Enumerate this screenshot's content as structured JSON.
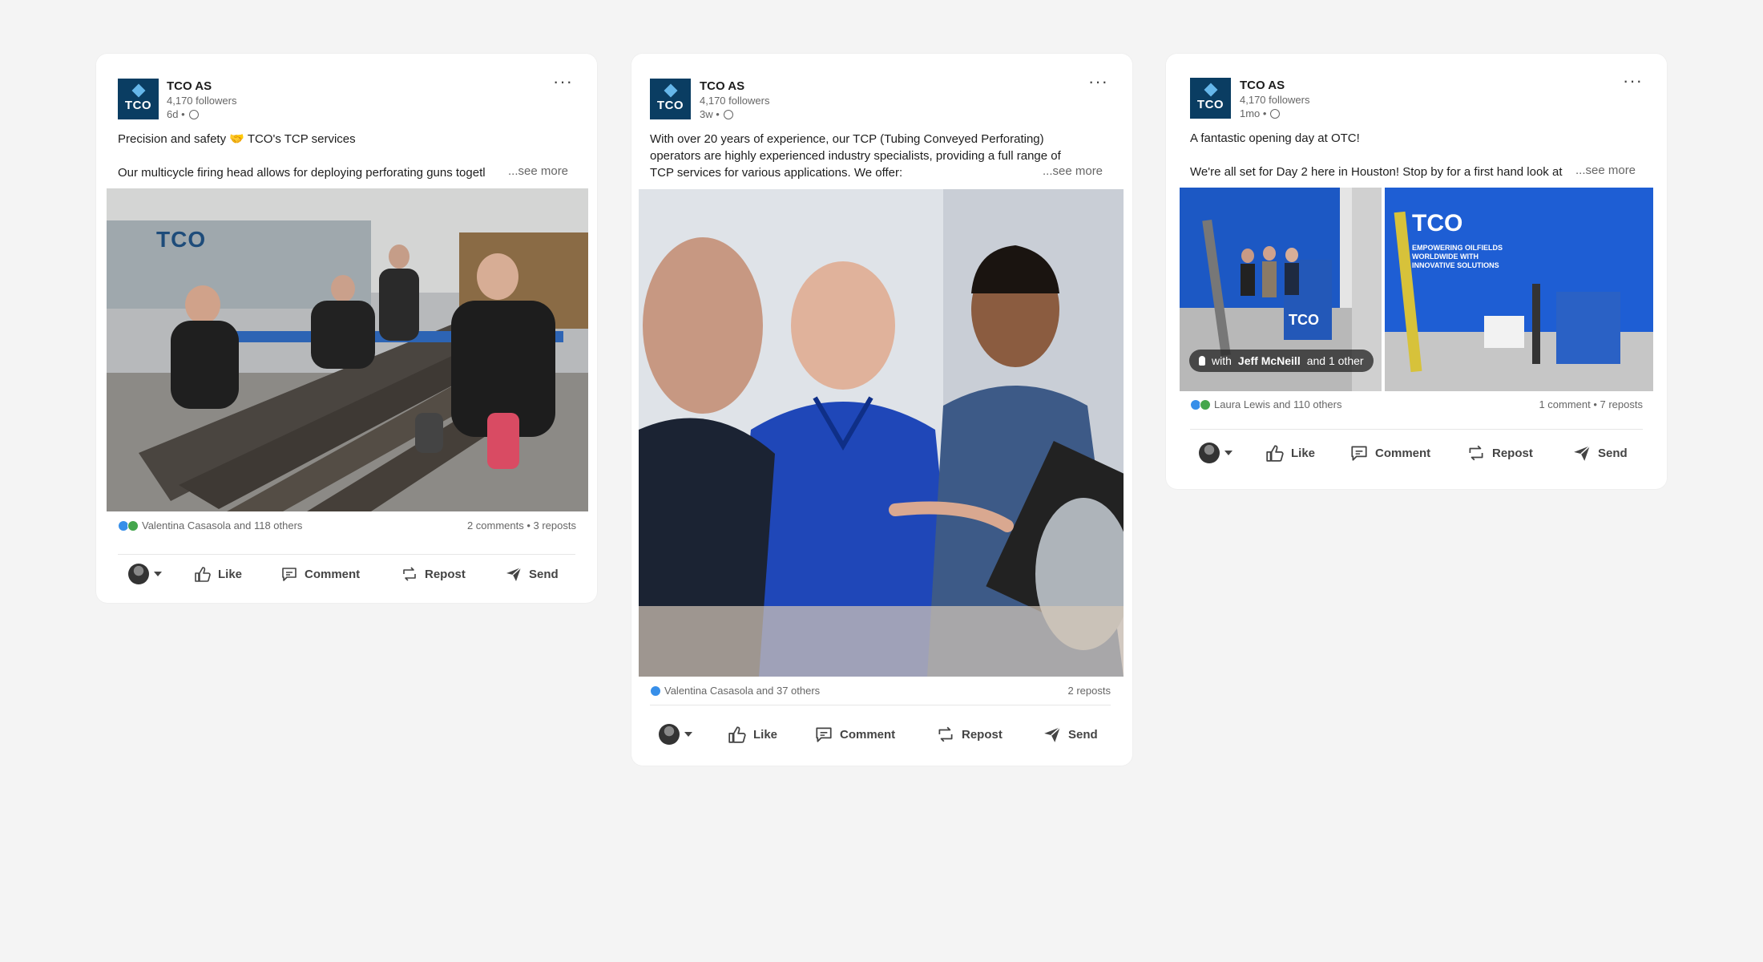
{
  "colors": {
    "brand": "#0a3d62",
    "accent": "#66b7ea",
    "like": "#378fe9",
    "celebrate": "#44a64c"
  },
  "posts": [
    {
      "company": "TCO AS",
      "logo_text": "TCO",
      "followers": "4,170 followers",
      "ago": "6d •",
      "line1": "Precision and safety 🤝 TCO's TCP services",
      "line2": "Our multicycle firing head allows for deploying perforating guns togetl",
      "see_more": "...see more",
      "photo_logo": "TCO",
      "reactions": "Valentina Casasola and 118 others",
      "counts": "2 comments • 3 reposts",
      "actions": {
        "like": "Like",
        "comment": "Comment",
        "repost": "Repost",
        "send": "Send"
      }
    },
    {
      "company": "TCO AS",
      "logo_text": "TCO",
      "followers": "4,170 followers",
      "ago": "3w •",
      "line1": "With over 20 years of experience, our TCP (Tubing Conveyed Perforating)",
      "line2": "operators are highly experienced industry specialists, providing a full range of",
      "line3": "TCP services for various applications. We offer:",
      "see_more": "...see more",
      "reactions": "Valentina Casasola and 37 others",
      "counts": "2 reposts",
      "actions": {
        "like": "Like",
        "comment": "Comment",
        "repost": "Repost",
        "send": "Send"
      }
    },
    {
      "company": "TCO AS",
      "logo_text": "TCO",
      "followers": "4,170 followers",
      "ago": "1mo •",
      "line1": "A fantastic opening day at OTC!",
      "line2": "We're all set for Day 2 here in Houston! Stop by for a first hand look at",
      "see_more": "...see more",
      "photo_logo": "TCO",
      "booth_text": "EMPOWERING OILFIELDS WORLDWIDE WITH INNOVATIVE SOLUTIONS",
      "tag_prefix": "with",
      "tag_name": "Jeff McNeill",
      "tag_suffix": "and 1 other",
      "reactions": "Laura Lewis and 110 others",
      "counts": "1 comment • 7 reposts",
      "actions": {
        "like": "Like",
        "comment": "Comment",
        "repost": "Repost",
        "send": "Send"
      }
    }
  ]
}
